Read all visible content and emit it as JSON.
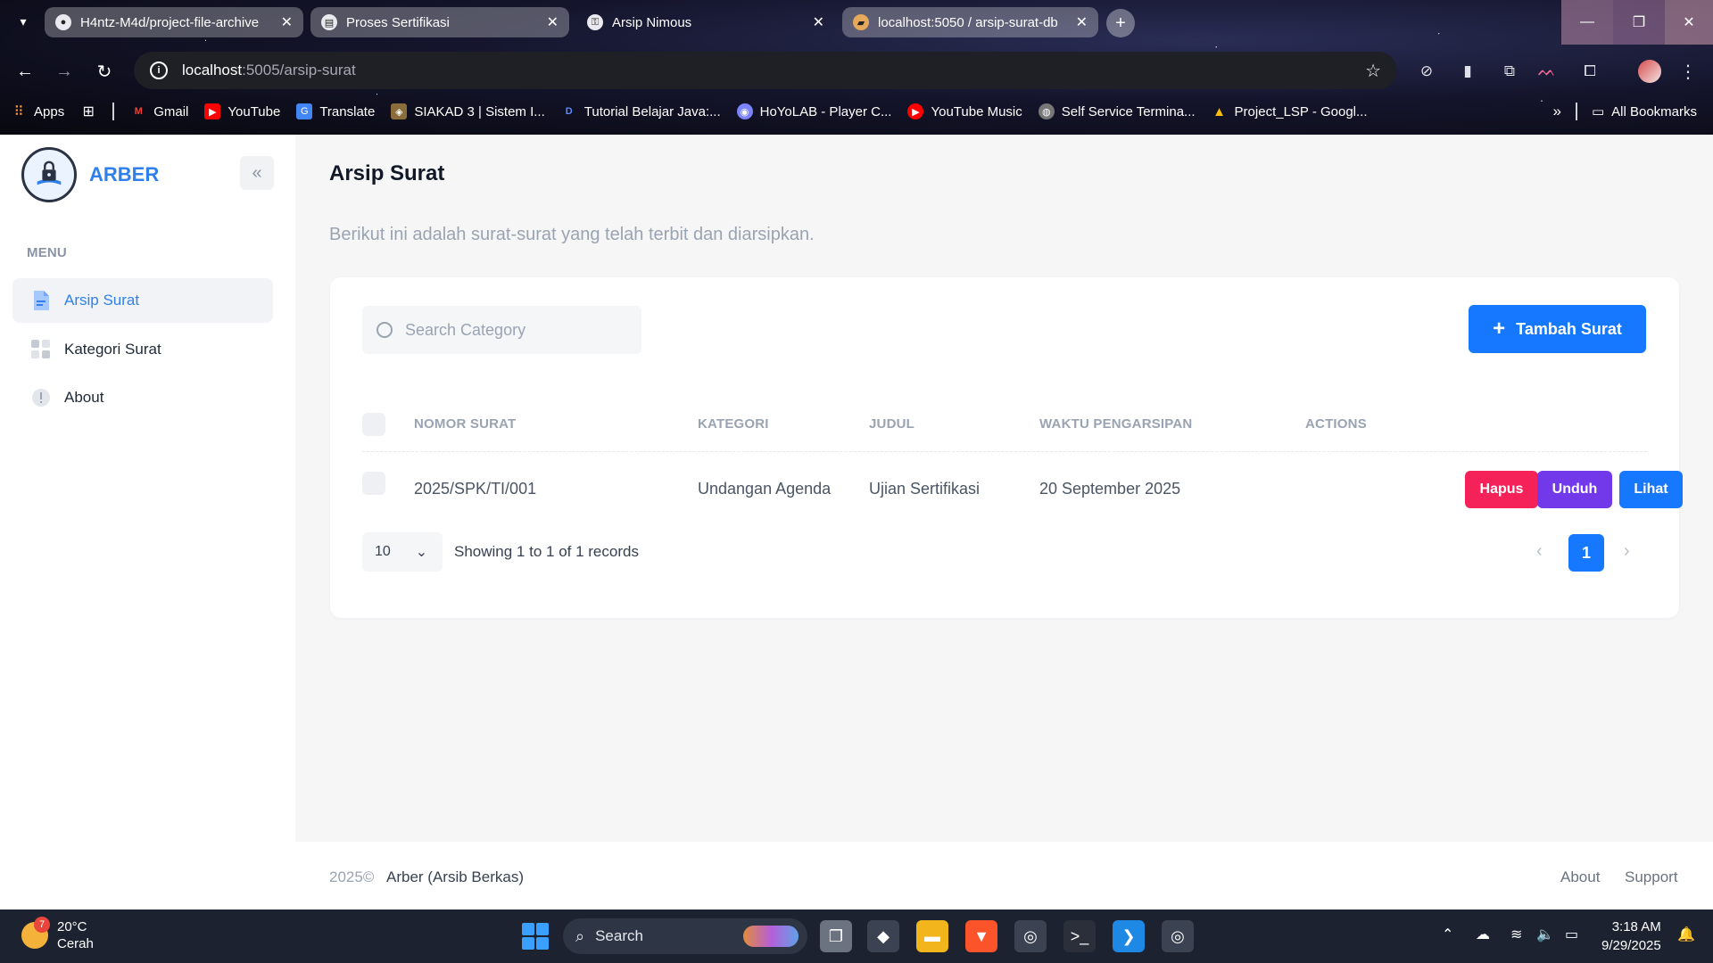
{
  "browser": {
    "tabs": [
      {
        "title": "H4ntz-M4d/project-file-archive",
        "icon": "github-icon"
      },
      {
        "title": "Proses Sertifikasi",
        "icon": "form-icon"
      },
      {
        "title": "Arsip Nimous",
        "icon": "lock-icon"
      },
      {
        "title": "localhost:5050 / arsip-surat-db",
        "icon": "database-icon"
      }
    ],
    "url_host": "localhost",
    "url_path": ":5005/arsip-surat",
    "bookmarks": [
      "Apps",
      "Gmail",
      "YouTube",
      "Translate",
      "SIAKAD 3 | Sistem I...",
      "Tutorial Belajar Java:...",
      "HoYoLAB - Player C...",
      "YouTube Music",
      "Self Service Termina...",
      "Project_LSP - Googl..."
    ],
    "all_bookmarks": "All Bookmarks"
  },
  "sidebar": {
    "brand": "ARBER",
    "menu_heading": "MENU",
    "items": [
      {
        "label": "Arsip Surat",
        "icon": "document-icon",
        "active": true
      },
      {
        "label": "Kategori Surat",
        "icon": "grid-icon",
        "active": false
      },
      {
        "label": "About",
        "icon": "info-icon",
        "active": false
      }
    ]
  },
  "main": {
    "title": "Arsip Surat",
    "subtitle": "Berikut ini adalah surat-surat yang telah terbit dan diarsipkan.",
    "search_placeholder": "Search Category",
    "add_button": "Tambah Surat",
    "table": {
      "headers": [
        "NOMOR SURAT",
        "KATEGORI",
        "JUDUL",
        "WAKTU PENGARSIPAN",
        "ACTIONS"
      ],
      "rows": [
        {
          "nomor": "2025/SPK/TI/001",
          "kategori": "Undangan Agenda",
          "judul": "Ujian Sertifikasi",
          "waktu": "20 September 2025"
        }
      ],
      "actions": [
        "Hapus",
        "Unduh",
        "Lihat"
      ]
    },
    "per_page": "10",
    "showing": "Showing 1 to 1 of 1 records",
    "current_page": "1"
  },
  "footer": {
    "year": "2025©",
    "name": "Arber (Arsib Berkas)",
    "links": [
      "About",
      "Support"
    ]
  },
  "taskbar": {
    "temp": "20°C",
    "weather": "Cerah",
    "weather_badge": "7",
    "search": "Search",
    "time": "3:18 AM",
    "date": "9/29/2025"
  },
  "colors": {
    "primary": "#1677ff",
    "danger": "#f5225a",
    "purple": "#7239ea",
    "brand": "#2f80ed"
  }
}
